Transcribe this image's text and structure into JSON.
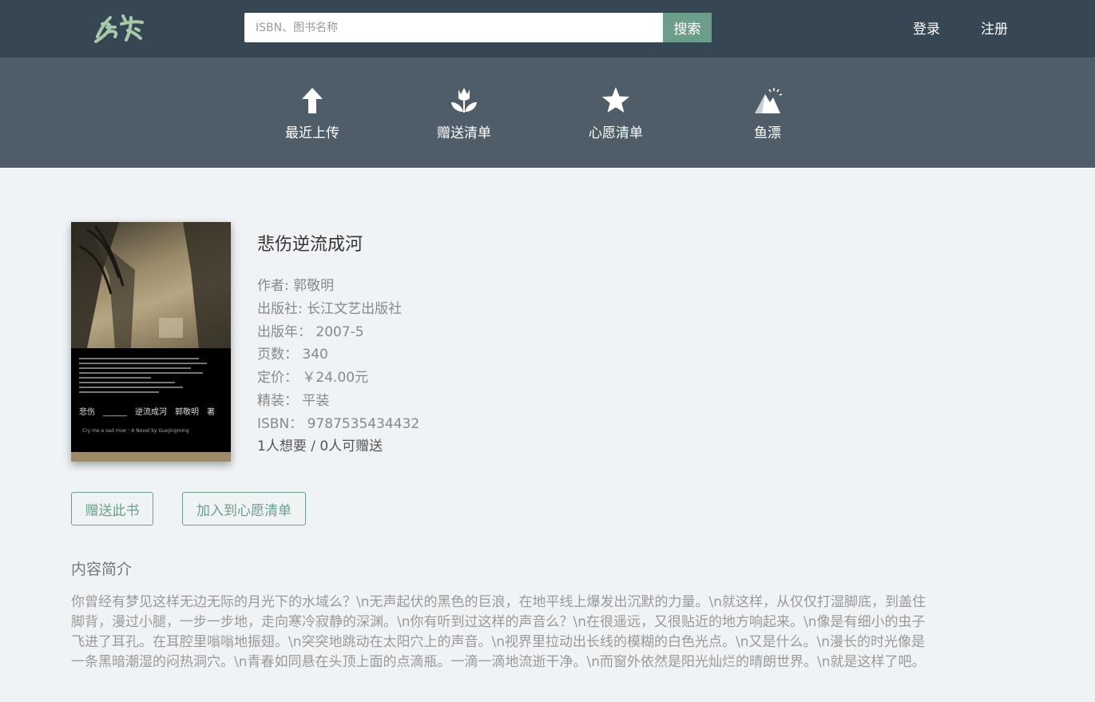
{
  "header": {
    "logo_text": "鱼书",
    "search_placeholder": "ISBN、图书名称",
    "search_button": "搜索",
    "login": "登录",
    "register": "注册"
  },
  "categories": [
    {
      "label": "最近上传",
      "icon": "up-arrow-icon"
    },
    {
      "label": "赠送清单",
      "icon": "flower-icon"
    },
    {
      "label": "心愿清单",
      "icon": "star-icon"
    },
    {
      "label": "鱼漂",
      "icon": "mountain-icon"
    }
  ],
  "book": {
    "title": "悲伤逆流成河",
    "author": "作者: 郭敬明",
    "publisher": "出版社: 长江文艺出版社",
    "pubdate": "出版年： 2007-5",
    "pages": "页数： 340",
    "price": "定价： ￥24.00元",
    "binding": "精装： 平装",
    "isbn": "ISBN： 9787535434432",
    "stats": "1人想要 / 0人可赠送",
    "cover_title": "悲伤　______　逆流成河　郭敬明　著",
    "cover_subtitle": "Cry me a sad river · A Novel by Guojingming"
  },
  "actions": {
    "give": "赠送此书",
    "wish": "加入到心愿清单"
  },
  "intro": {
    "heading": "内容简介",
    "text": "你曾经有梦见这样无边无际的月光下的水域么？\\n无声起伏的黑色的巨浪，在地平线上爆发出沉默的力量。\\n就这样，从仅仅打湿脚底，到盖住脚背，漫过小腿，一步一步地，走向寒冷寂静的深渊。\\n你有听到过这样的声音么？\\n在很遥远，又很贴近的地方响起来。\\n像是有细小的虫子飞进了耳孔。在耳腔里嗡嗡地振翅。\\n突突地跳动在太阳穴上的声音。\\n视界里拉动出长线的模糊的白色光点。\\n又是什么。\\n漫长的时光像是一条黑暗潮湿的闷热洞穴。\\n青春如同悬在头顶上面的点滴瓶。一滴一滴地流逝干净。\\n而窗外依然是阳光灿烂的晴朗世界。\\n就是这样了吧。"
  },
  "colors": {
    "header_bg": "#364653",
    "category_bg": "#4f5d69",
    "accent": "#6d9e8b",
    "page_bg": "#f0f3f6"
  }
}
